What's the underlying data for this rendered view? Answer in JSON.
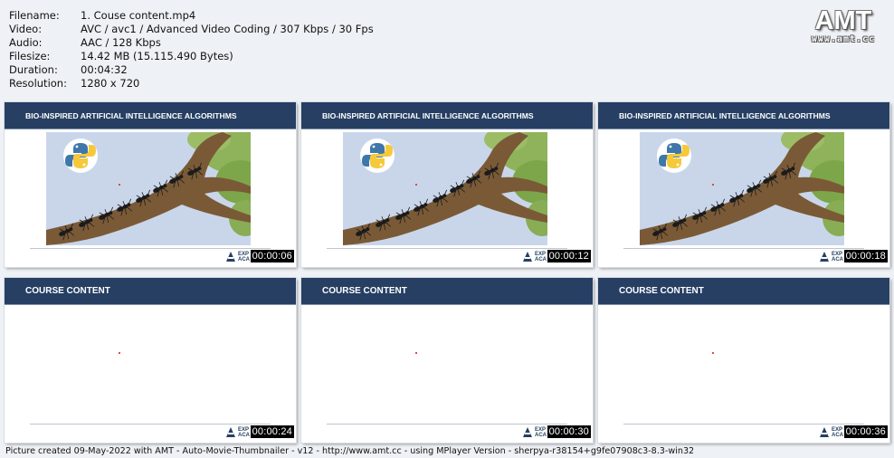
{
  "info": {
    "rows": [
      {
        "label": "Filename:",
        "value": "1. Couse content.mp4"
      },
      {
        "label": "Video:",
        "value": "AVC / avc1 / Advanced Video Coding / 307 Kbps / 30 Fps"
      },
      {
        "label": "Audio:",
        "value": "AAC / 128 Kbps"
      },
      {
        "label": "Filesize:",
        "value": "14.42 MB (15.115.490 Bytes)"
      },
      {
        "label": "Duration:",
        "value": "00:04:32"
      },
      {
        "label": "Resolution:",
        "value": "1280 x 720"
      }
    ]
  },
  "logo": {
    "main": "AMT",
    "url": "www.amt.cc"
  },
  "thumbnails": [
    {
      "title": "BIO-INSPIRED ARTIFICIAL INTELLIGENCE ALGORITHMS",
      "time": "00:00:06",
      "kind": "ant"
    },
    {
      "title": "BIO-INSPIRED ARTIFICIAL INTELLIGENCE ALGORITHMS",
      "time": "00:00:12",
      "kind": "ant"
    },
    {
      "title": "BIO-INSPIRED ARTIFICIAL INTELLIGENCE ALGORITHMS",
      "time": "00:00:18",
      "kind": "ant"
    },
    {
      "title": "COURSE CONTENT",
      "time": "00:00:24",
      "kind": "blank"
    },
    {
      "title": "COURSE CONTENT",
      "time": "00:00:30",
      "kind": "blank"
    },
    {
      "title": "COURSE CONTENT",
      "time": "00:00:36",
      "kind": "blank"
    }
  ],
  "brand_text": "EXP ACA",
  "footer": "Picture created 09-May-2022 with AMT - Auto-Movie-Thumbnailer - v12 - http://www.amt.cc - using MPlayer Version - sherpya-r38154+g9fe07908c3-8.3-win32",
  "colors": {
    "slide_header": "#263f63",
    "sky": "#c9d6ea",
    "branch": "#7a5a36",
    "leaves": "#8fb35a"
  }
}
